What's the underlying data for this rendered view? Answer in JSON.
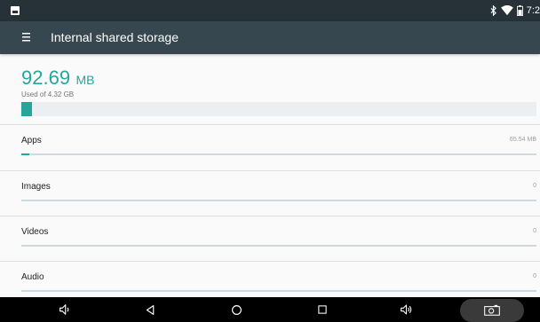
{
  "status_bar": {
    "time": "7:2",
    "icons": [
      "notification-icon",
      "bluetooth-icon",
      "wifi-icon",
      "battery-icon"
    ]
  },
  "app_bar": {
    "title": "Internal shared storage",
    "menu_icon": "menu-icon"
  },
  "summary": {
    "used_value": "92.69",
    "used_unit": "MB",
    "caption": "Used of 4.32 GB",
    "used_fraction": 0.021
  },
  "categories": [
    {
      "label": "Apps",
      "size": "65.54 MB",
      "fraction": 0.015
    },
    {
      "label": "Images",
      "size": "0",
      "fraction": 0
    },
    {
      "label": "Videos",
      "size": "0",
      "fraction": 0
    },
    {
      "label": "Audio",
      "size": "0",
      "fraction": 0
    }
  ],
  "nav_bar": {
    "buttons": [
      "volume-down-icon",
      "back-icon",
      "home-icon",
      "recents-icon",
      "volume-up-icon",
      "screenshot-icon"
    ]
  },
  "colors": {
    "accent": "#26a69a",
    "app_bar": "#37474f",
    "status_bar": "#263238",
    "nav_bar": "#000000"
  }
}
